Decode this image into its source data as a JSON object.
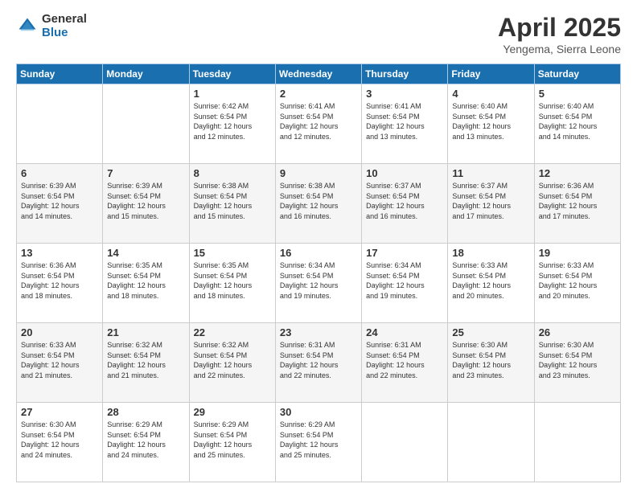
{
  "header": {
    "logo_general": "General",
    "logo_blue": "Blue",
    "title": "April 2025",
    "subtitle": "Yengema, Sierra Leone"
  },
  "weekdays": [
    "Sunday",
    "Monday",
    "Tuesday",
    "Wednesday",
    "Thursday",
    "Friday",
    "Saturday"
  ],
  "weeks": [
    [
      {
        "day": "",
        "info": ""
      },
      {
        "day": "",
        "info": ""
      },
      {
        "day": "1",
        "info": "Sunrise: 6:42 AM\nSunset: 6:54 PM\nDaylight: 12 hours\nand 12 minutes."
      },
      {
        "day": "2",
        "info": "Sunrise: 6:41 AM\nSunset: 6:54 PM\nDaylight: 12 hours\nand 12 minutes."
      },
      {
        "day": "3",
        "info": "Sunrise: 6:41 AM\nSunset: 6:54 PM\nDaylight: 12 hours\nand 13 minutes."
      },
      {
        "day": "4",
        "info": "Sunrise: 6:40 AM\nSunset: 6:54 PM\nDaylight: 12 hours\nand 13 minutes."
      },
      {
        "day": "5",
        "info": "Sunrise: 6:40 AM\nSunset: 6:54 PM\nDaylight: 12 hours\nand 14 minutes."
      }
    ],
    [
      {
        "day": "6",
        "info": "Sunrise: 6:39 AM\nSunset: 6:54 PM\nDaylight: 12 hours\nand 14 minutes."
      },
      {
        "day": "7",
        "info": "Sunrise: 6:39 AM\nSunset: 6:54 PM\nDaylight: 12 hours\nand 15 minutes."
      },
      {
        "day": "8",
        "info": "Sunrise: 6:38 AM\nSunset: 6:54 PM\nDaylight: 12 hours\nand 15 minutes."
      },
      {
        "day": "9",
        "info": "Sunrise: 6:38 AM\nSunset: 6:54 PM\nDaylight: 12 hours\nand 16 minutes."
      },
      {
        "day": "10",
        "info": "Sunrise: 6:37 AM\nSunset: 6:54 PM\nDaylight: 12 hours\nand 16 minutes."
      },
      {
        "day": "11",
        "info": "Sunrise: 6:37 AM\nSunset: 6:54 PM\nDaylight: 12 hours\nand 17 minutes."
      },
      {
        "day": "12",
        "info": "Sunrise: 6:36 AM\nSunset: 6:54 PM\nDaylight: 12 hours\nand 17 minutes."
      }
    ],
    [
      {
        "day": "13",
        "info": "Sunrise: 6:36 AM\nSunset: 6:54 PM\nDaylight: 12 hours\nand 18 minutes."
      },
      {
        "day": "14",
        "info": "Sunrise: 6:35 AM\nSunset: 6:54 PM\nDaylight: 12 hours\nand 18 minutes."
      },
      {
        "day": "15",
        "info": "Sunrise: 6:35 AM\nSunset: 6:54 PM\nDaylight: 12 hours\nand 18 minutes."
      },
      {
        "day": "16",
        "info": "Sunrise: 6:34 AM\nSunset: 6:54 PM\nDaylight: 12 hours\nand 19 minutes."
      },
      {
        "day": "17",
        "info": "Sunrise: 6:34 AM\nSunset: 6:54 PM\nDaylight: 12 hours\nand 19 minutes."
      },
      {
        "day": "18",
        "info": "Sunrise: 6:33 AM\nSunset: 6:54 PM\nDaylight: 12 hours\nand 20 minutes."
      },
      {
        "day": "19",
        "info": "Sunrise: 6:33 AM\nSunset: 6:54 PM\nDaylight: 12 hours\nand 20 minutes."
      }
    ],
    [
      {
        "day": "20",
        "info": "Sunrise: 6:33 AM\nSunset: 6:54 PM\nDaylight: 12 hours\nand 21 minutes."
      },
      {
        "day": "21",
        "info": "Sunrise: 6:32 AM\nSunset: 6:54 PM\nDaylight: 12 hours\nand 21 minutes."
      },
      {
        "day": "22",
        "info": "Sunrise: 6:32 AM\nSunset: 6:54 PM\nDaylight: 12 hours\nand 22 minutes."
      },
      {
        "day": "23",
        "info": "Sunrise: 6:31 AM\nSunset: 6:54 PM\nDaylight: 12 hours\nand 22 minutes."
      },
      {
        "day": "24",
        "info": "Sunrise: 6:31 AM\nSunset: 6:54 PM\nDaylight: 12 hours\nand 22 minutes."
      },
      {
        "day": "25",
        "info": "Sunrise: 6:30 AM\nSunset: 6:54 PM\nDaylight: 12 hours\nand 23 minutes."
      },
      {
        "day": "26",
        "info": "Sunrise: 6:30 AM\nSunset: 6:54 PM\nDaylight: 12 hours\nand 23 minutes."
      }
    ],
    [
      {
        "day": "27",
        "info": "Sunrise: 6:30 AM\nSunset: 6:54 PM\nDaylight: 12 hours\nand 24 minutes."
      },
      {
        "day": "28",
        "info": "Sunrise: 6:29 AM\nSunset: 6:54 PM\nDaylight: 12 hours\nand 24 minutes."
      },
      {
        "day": "29",
        "info": "Sunrise: 6:29 AM\nSunset: 6:54 PM\nDaylight: 12 hours\nand 25 minutes."
      },
      {
        "day": "30",
        "info": "Sunrise: 6:29 AM\nSunset: 6:54 PM\nDaylight: 12 hours\nand 25 minutes."
      },
      {
        "day": "",
        "info": ""
      },
      {
        "day": "",
        "info": ""
      },
      {
        "day": "",
        "info": ""
      }
    ]
  ]
}
